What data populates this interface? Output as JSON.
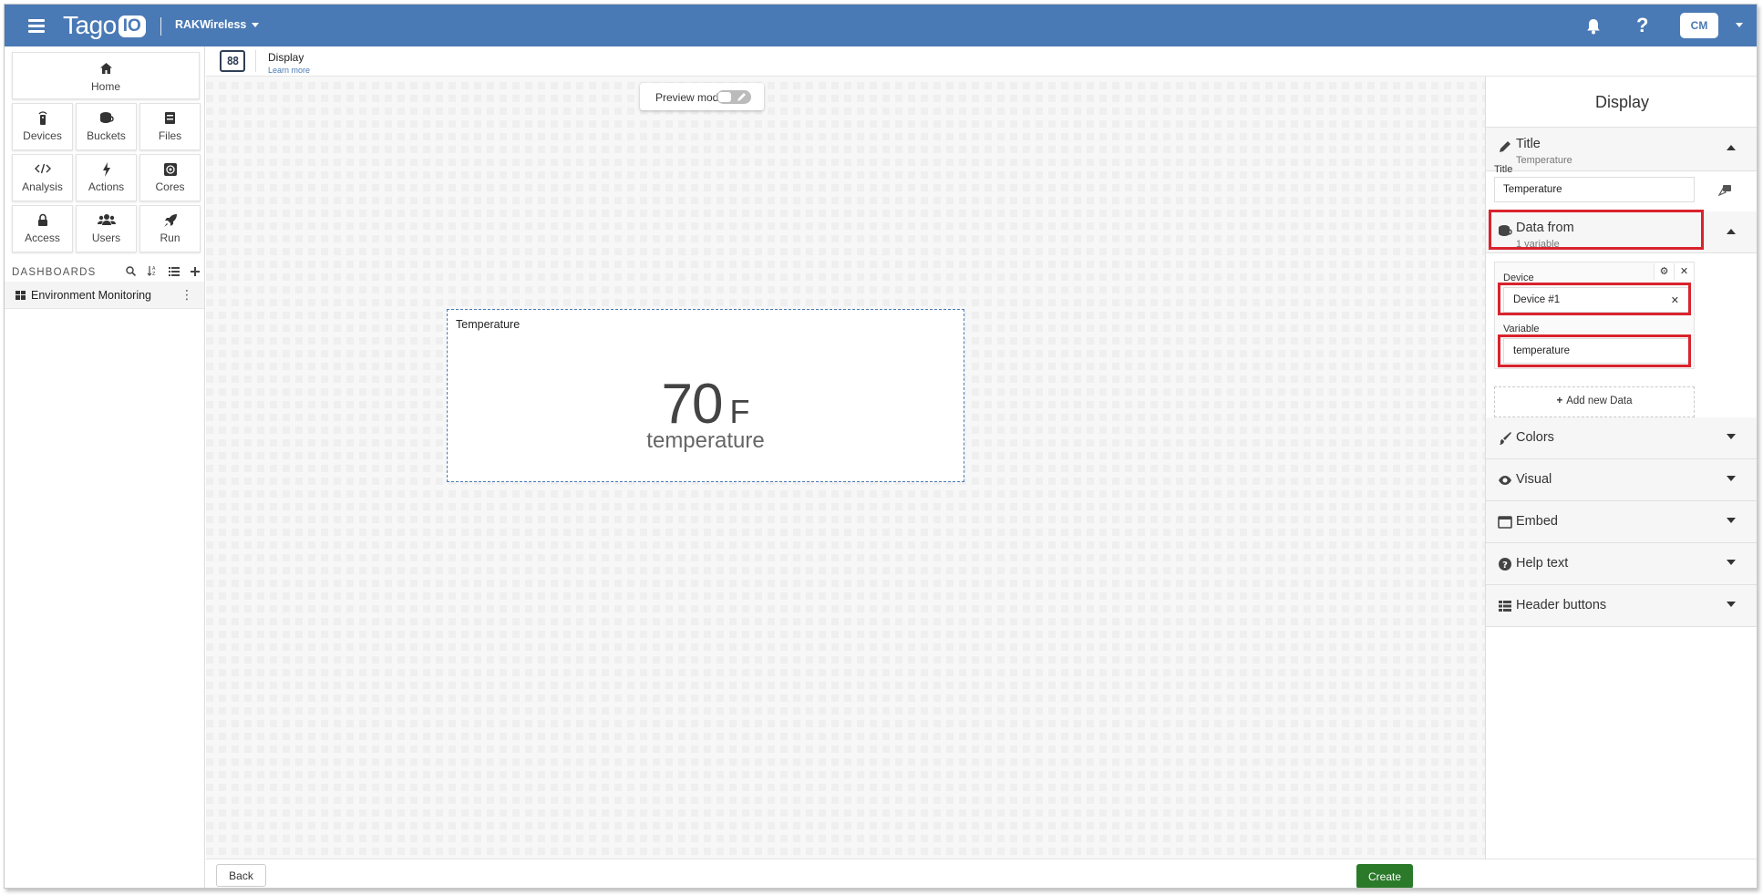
{
  "topbar": {
    "logo_text": "Tago",
    "logo_badge": "IO",
    "account_name": "RAKWireless",
    "help_glyph": "?",
    "user_initials": "CM",
    "bg_color": "#4a7ab5"
  },
  "sidebar": {
    "home_label": "Home",
    "tiles": [
      {
        "label": "Devices",
        "icon": "device-icon"
      },
      {
        "label": "Buckets",
        "icon": "bucket-icon"
      },
      {
        "label": "Files",
        "icon": "files-icon"
      },
      {
        "label": "Analysis",
        "icon": "code-icon"
      },
      {
        "label": "Actions",
        "icon": "bolt-icon"
      },
      {
        "label": "Cores",
        "icon": "cores-icon"
      },
      {
        "label": "Access",
        "icon": "lock-icon"
      },
      {
        "label": "Users",
        "icon": "users-icon"
      },
      {
        "label": "Run",
        "icon": "rocket-icon"
      }
    ],
    "dashboards_header": "DASHBOARDS",
    "dashboards": [
      {
        "label": "Environment Monitoring"
      }
    ]
  },
  "content_header": {
    "widget_badge": "88",
    "widget_type": "Display",
    "learn_more": "Learn more"
  },
  "canvas": {
    "preview_label": "Preview mode",
    "widget": {
      "title": "Temperature",
      "value": "70",
      "unit": "F",
      "variable": "temperature"
    }
  },
  "footer": {
    "back_label": "Back",
    "create_label": "Create",
    "create_color": "#2a7a2a"
  },
  "panel": {
    "title": "Display",
    "title_section": {
      "name": "Title",
      "subtitle": "Temperature",
      "field_label": "Title",
      "field_value": "Temperature"
    },
    "data_section": {
      "name": "Data from",
      "subtitle": "1 variable",
      "device_label": "Device",
      "device_value": "Device #1",
      "variable_label": "Variable",
      "variable_value": "temperature",
      "add_label": "Add new Data"
    },
    "collapsed_sections": [
      {
        "name": "Colors",
        "icon": "brush-icon"
      },
      {
        "name": "Visual",
        "icon": "eye-icon"
      },
      {
        "name": "Embed",
        "icon": "window-icon"
      },
      {
        "name": "Help text",
        "icon": "question-circle-icon"
      },
      {
        "name": "Header buttons",
        "icon": "table-icon"
      }
    ]
  },
  "highlight_color": "#d9232d"
}
